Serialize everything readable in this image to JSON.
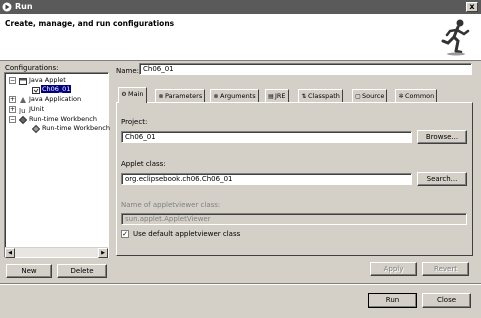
{
  "window": {
    "title": "Run",
    "close_label": "x"
  },
  "banner": {
    "headline": "Create, manage, and run configurations"
  },
  "configurations": {
    "label": "Configurations:",
    "tree": [
      {
        "label": "Java Applet",
        "expander": "⊟"
      },
      {
        "label": "Ch06_01"
      },
      {
        "label": "Java Application",
        "expander": "⊞"
      },
      {
        "label": "JUnit",
        "expander": "⊞"
      },
      {
        "label": "Run-time Workbench",
        "expander": "⊟"
      },
      {
        "label": "Run-time Workbench"
      }
    ],
    "new_label": "New",
    "delete_label": "Delete"
  },
  "name": {
    "label": "Name:",
    "value": "Ch06_01"
  },
  "tabs": [
    {
      "label": "Main",
      "icon": "gear-icon"
    },
    {
      "label": "Parameters",
      "icon": "x-equals-icon"
    },
    {
      "label": "Arguments",
      "icon": "x-equals-icon"
    },
    {
      "label": "JRE",
      "icon": "jar-icon"
    },
    {
      "label": "Classpath",
      "icon": "classpath-icon"
    },
    {
      "label": "Source",
      "icon": "document-icon"
    },
    {
      "label": "Common",
      "icon": "settings-icon"
    }
  ],
  "main_tab": {
    "project_label": "Project:",
    "project_value": "Ch06_01",
    "browse_label": "Browse...",
    "applet_class_label": "Applet class:",
    "applet_class_value": "org.eclipsebook.ch06.Ch06_01",
    "search_label": "Search...",
    "viewer_label": "Name of appletviewer class:",
    "viewer_value": "sun.applet.AppletViewer",
    "default_viewer_label": "Use default appletviewer class",
    "default_viewer_checked": true
  },
  "actions": {
    "apply_label": "Apply",
    "revert_label": "Revert",
    "run_label": "Run",
    "close_label": "Close"
  }
}
